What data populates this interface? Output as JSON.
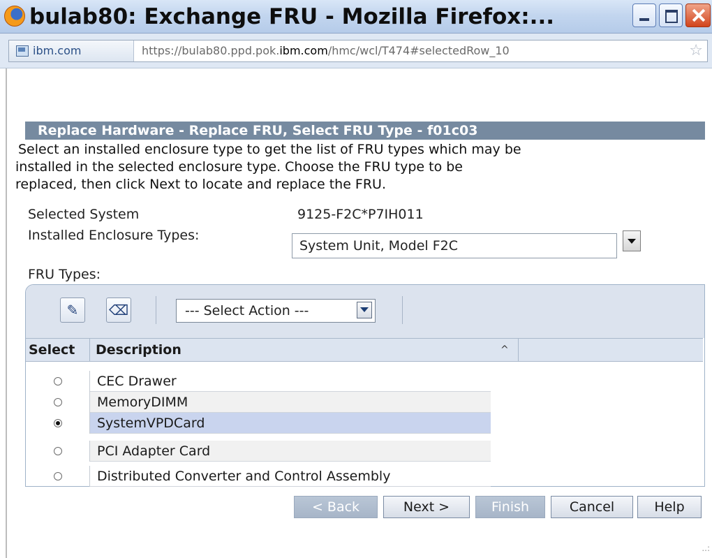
{
  "window": {
    "title": "bulab80: Exchange FRU - Mozilla Firefox:...",
    "icon": "firefox-icon"
  },
  "urlbar": {
    "site_badge": "ibm.com",
    "url_prefix": "https://bulab80.ppd.pok.",
    "url_domain": "ibm.com",
    "url_suffix": "/hmc/wcl/T474#selectedRow_10"
  },
  "panel": {
    "title": "Replace Hardware - Replace FRU, Select FRU Type - f01c03",
    "instructions": [
      "Select an installed enclosure type to get the list of FRU types which may be",
      "installed in the selected enclosure type. Choose the FRU type to be",
      "replaced, then click Next to locate and replace the FRU."
    ],
    "selected_system_label": "Selected System",
    "selected_system_value": "9125-F2C*P7IH011",
    "enclosure_label": "Installed Enclosure Types:",
    "enclosure_value": "System Unit, Model F2C",
    "fru_types_label": "FRU Types:"
  },
  "table": {
    "action_select": "--- Select Action ---",
    "columns": [
      "Select",
      "Description"
    ],
    "rows": [
      {
        "description": "CEC Drawer",
        "selected": false
      },
      {
        "description": "MemoryDIMM",
        "selected": false
      },
      {
        "description": "SystemVPDCard",
        "selected": true
      },
      {
        "description": "PCI Adapter Card",
        "selected": false
      },
      {
        "description": "Distributed Converter and Control Assembly",
        "selected": false
      }
    ]
  },
  "buttons": {
    "back": "< Back",
    "next": "Next >",
    "finish": "Finish",
    "cancel": "Cancel",
    "help": "Help"
  },
  "colors": {
    "panel_title_bg": "#768aa0",
    "selected_row": "#c9d4ee",
    "toolbar_bg": "#dce3ee"
  }
}
